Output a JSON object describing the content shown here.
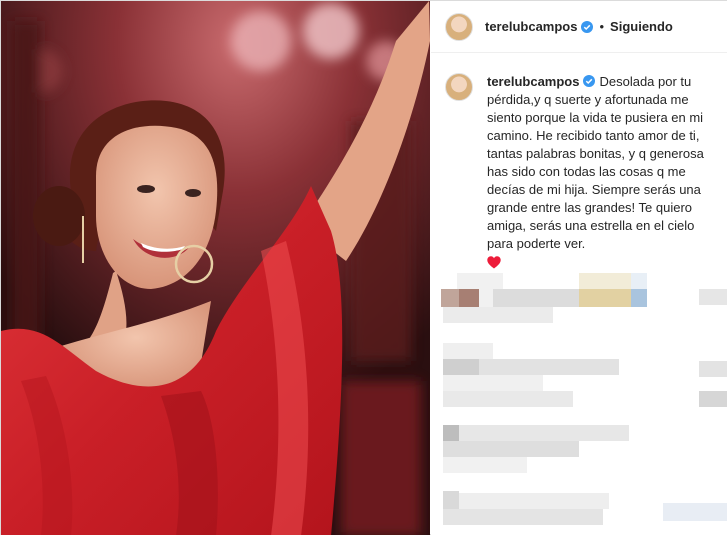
{
  "header": {
    "username": "terelubcampos",
    "separator": "•",
    "follow_status": "Siguiendo"
  },
  "caption": {
    "username": "terelubcampos",
    "text": "Desolada por tu pérdida,y q suerte y afortunada me siento porque la vida te pusiera en mi camino. He recibido tanto amor de ti, tantas palabras bonitas, y q generosa has sido con todas las cosas q me decías de mi hija. Siempre serás una grande entre las grandes! Te quiero amiga, serás una estrella en el cielo para poderte ver.",
    "emoji": "heart-icon"
  },
  "colors": {
    "verified": "#3897f0",
    "heart": "#ed1c3a",
    "dress": "#d8262c"
  }
}
